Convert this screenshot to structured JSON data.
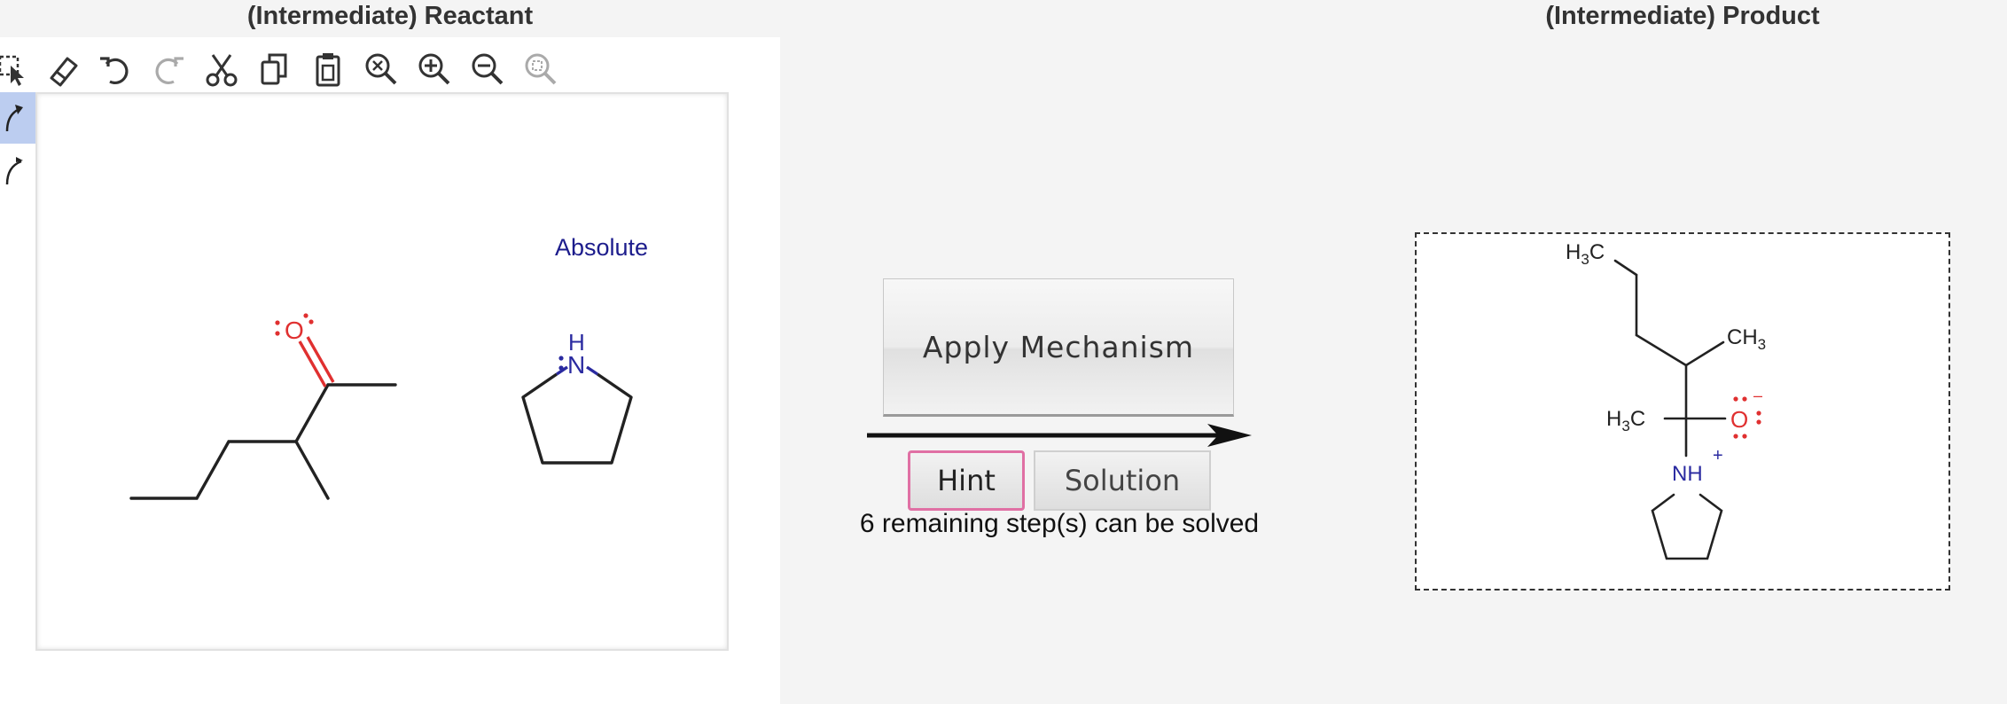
{
  "headings": {
    "reactant": "(Intermediate) Reactant",
    "product": "(Intermediate) Product"
  },
  "toolbar": {
    "items": [
      {
        "name": "select-icon"
      },
      {
        "name": "eraser-icon"
      },
      {
        "name": "undo-icon"
      },
      {
        "name": "redo-icon",
        "disabled": true
      },
      {
        "name": "cut-icon"
      },
      {
        "name": "copy-icon"
      },
      {
        "name": "paste-icon"
      },
      {
        "name": "zoom-reset-icon"
      },
      {
        "name": "zoom-in-icon"
      },
      {
        "name": "zoom-out-icon"
      },
      {
        "name": "zoom-fit-icon",
        "disabled": true
      }
    ]
  },
  "side_tools": [
    {
      "name": "curved-arrow-electron-pair-icon",
      "active": true
    },
    {
      "name": "curved-arrow-single-electron-icon",
      "active": false
    }
  ],
  "reactant_canvas": {
    "stereo_label": "Absolute",
    "ketone_oxygen": "O",
    "amine_atom": "N",
    "amine_h": "H"
  },
  "mechanism": {
    "apply_label": "Apply Mechanism",
    "hint_label": "Hint",
    "solution_label": "Solution",
    "remaining_text": "6 remaining step(s) can be solved"
  },
  "product": {
    "top_methyl": {
      "main": "H",
      "sub": "3",
      "tail": "C"
    },
    "branch_methyl": {
      "main": "CH",
      "sub": "3"
    },
    "left_methyl": {
      "main": "H",
      "sub": "3",
      "tail": "C"
    },
    "oxygen": "O",
    "oxygen_charge": "–",
    "nh_label": "NH",
    "nh_charge": "+"
  },
  "colors": {
    "oxygen": "#e03030",
    "nitrogen": "#2a2aa0",
    "hint_border": "#e070a4",
    "active_tool": "#bccdf0"
  }
}
